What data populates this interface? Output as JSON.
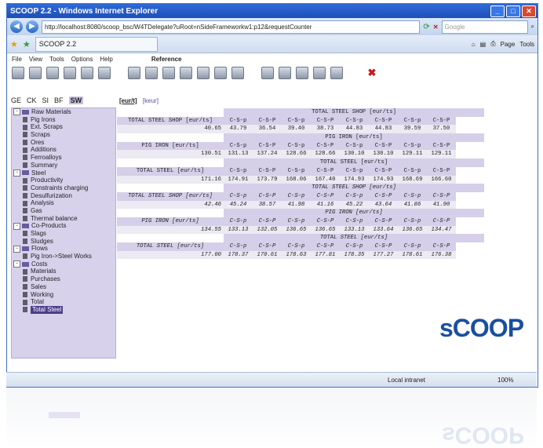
{
  "window": {
    "title": "SCOOP 2.2 - Windows Internet Explorer",
    "url": "http://localhost:8080/scoop_bsc/W4TDelegate?uRoot=nSideFrameworkw1:p12&requestCounter",
    "search_placeholder": "Google",
    "tab_title": "SCOOP 2.2",
    "page_menu": "Page",
    "tools_menu": "Tools"
  },
  "menu": [
    "File",
    "View",
    "Tools",
    "Options",
    "Help"
  ],
  "reference_label": "Reference",
  "modes": [
    "GE",
    "CK",
    "SI",
    "BF",
    "SW"
  ],
  "units": [
    "[eur/t]",
    "[keur]"
  ],
  "tree": [
    {
      "label": "Raw Materials",
      "level": 0
    },
    {
      "label": "Pig Irons",
      "level": 1
    },
    {
      "label": "Ext. Scraps",
      "level": 1
    },
    {
      "label": "Scraps",
      "level": 1
    },
    {
      "label": "Ores",
      "level": 1
    },
    {
      "label": "Additions",
      "level": 1
    },
    {
      "label": "Ferroalloys",
      "level": 1
    },
    {
      "label": "Summary",
      "level": 1
    },
    {
      "label": "Steel",
      "level": 0
    },
    {
      "label": "Productivity",
      "level": 1
    },
    {
      "label": "Constraints charging",
      "level": 1
    },
    {
      "label": "Desulfurization",
      "level": 1
    },
    {
      "label": "Analysis",
      "level": 1
    },
    {
      "label": "Gas",
      "level": 1
    },
    {
      "label": "Thermal balance",
      "level": 1
    },
    {
      "label": "Co-Products",
      "level": 0
    },
    {
      "label": "Slags",
      "level": 1
    },
    {
      "label": "Sludges",
      "level": 1
    },
    {
      "label": "Flows",
      "level": 0
    },
    {
      "label": "Pig Iron->Steel Works",
      "level": 1
    },
    {
      "label": "Costs",
      "level": 0
    },
    {
      "label": "Materials",
      "level": 1
    },
    {
      "label": "Purchases",
      "level": 1
    },
    {
      "label": "Sales",
      "level": 1
    },
    {
      "label": "Working",
      "level": 1
    },
    {
      "label": "Total",
      "level": 1
    },
    {
      "label": "Total Steel",
      "level": 1,
      "selected": true
    }
  ],
  "report": {
    "columns": [
      "C-S-p",
      "C-S-P",
      "C-S-p",
      "C-S-P",
      "C-S-p",
      "C-S-P",
      "C-S-p",
      "C-S-P"
    ],
    "sections": [
      {
        "title": "TOTAL STEEL SHOP [eur/ts]",
        "label": "TOTAL STEEL SHOP [eur/ts]",
        "main": "40.65",
        "values": [
          "43.79",
          "36.54",
          "39.40",
          "38.73",
          "44.83",
          "44.83",
          "39.59",
          "37.50"
        ],
        "italic": false
      },
      {
        "title": "PIG IRON [eur/ts]",
        "label": "PIG IRON [eur/ts]",
        "main": "130.51",
        "values": [
          "131.13",
          "137.24",
          "128.66",
          "128.66",
          "130.10",
          "130.10",
          "129.11",
          "129.11"
        ],
        "italic": false
      },
      {
        "title": "TOTAL STEEL [eur/ts]",
        "label": "TOTAL STEEL [eur/ts]",
        "main": "171.16",
        "values": [
          "174.91",
          "173.79",
          "168.06",
          "167.40",
          "174.93",
          "174.93",
          "168.69",
          "166.60"
        ],
        "italic": false
      },
      {
        "title": "TOTAL STEEL SHOP [eur/ts]",
        "label": "TOTAL STEEL SHOP [eur/ts]",
        "main": "42.46",
        "values": [
          "45.24",
          "38.57",
          "41.98",
          "41.16",
          "45.22",
          "43.64",
          "41.86",
          "41.90"
        ],
        "italic": true
      },
      {
        "title": "PIG IRON [eur/ts]",
        "label": "PIG IRON [eur/ts]",
        "main": "134.55",
        "values": [
          "133.13",
          "132.05",
          "136.65",
          "136.65",
          "133.13",
          "133.64",
          "136.65",
          "134.47"
        ],
        "italic": true
      },
      {
        "title": "TOTAL STEEL [eur/ts]",
        "label": "TOTAL STEEL [eur/ts]",
        "main": "177.00",
        "values": [
          "178.37",
          "170.61",
          "178.63",
          "177.81",
          "178.35",
          "177.27",
          "178.61",
          "176.38"
        ],
        "italic": true
      }
    ]
  },
  "logo": {
    "text": "sCOOP"
  },
  "status": {
    "zone": "Local intranet",
    "zoom": "100%"
  }
}
